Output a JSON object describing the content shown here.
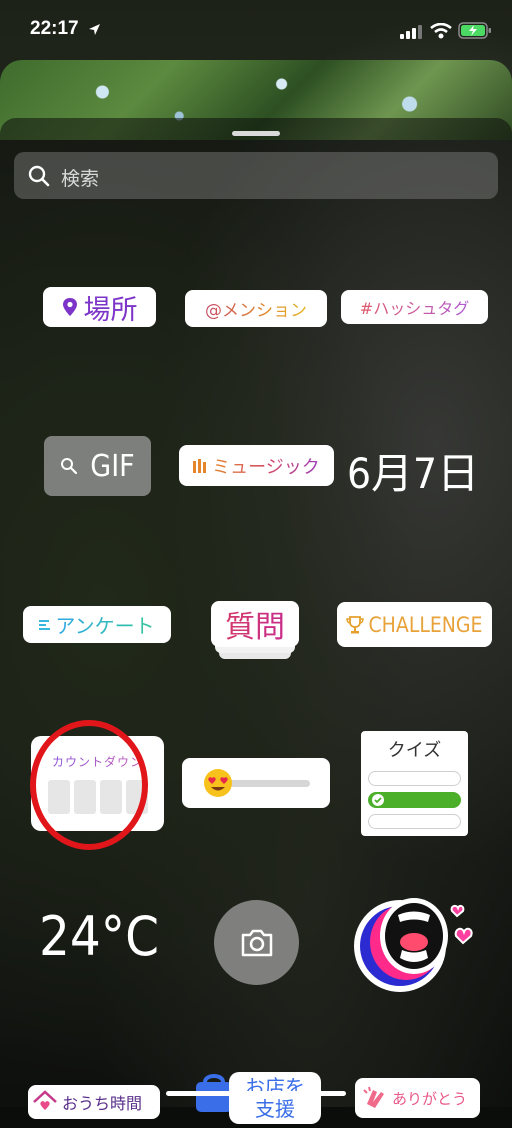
{
  "status_bar": {
    "time": "22:17"
  },
  "search": {
    "placeholder": "検索"
  },
  "stickers": {
    "location": "場所",
    "mention": "@メンション",
    "hashtag": "#ハッシュタグ",
    "gif": "GIF",
    "music": "ミュージック",
    "date": "6月7日",
    "poll": "アンケート",
    "question": "質問",
    "challenge": "CHALLENGE",
    "countdown": "カウントダウン",
    "quiz": "クイズ",
    "temperature": "24°C",
    "home": "おうち時間",
    "shop_line1": "お店を",
    "shop_line2": "支援",
    "thanks": "ありがとう"
  },
  "colors": {
    "mention": "#d4612c",
    "hashtag": "#b05bd0",
    "location": "#7d35c9",
    "quiz_correct": "#4caf2a",
    "highlight_circle": "#e0161a"
  }
}
